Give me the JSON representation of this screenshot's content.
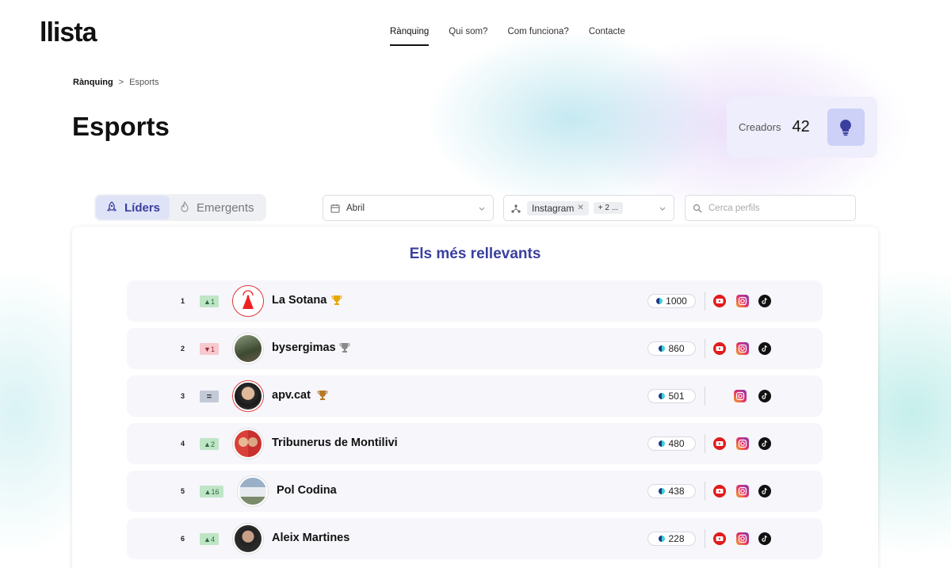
{
  "header": {
    "logo": "llista",
    "nav": [
      {
        "label": "Rànquing",
        "active": true
      },
      {
        "label": "Qui som?",
        "active": false
      },
      {
        "label": "Com funciona?",
        "active": false
      },
      {
        "label": "Contacte",
        "active": false
      }
    ]
  },
  "breadcrumb": {
    "root": "Rànquing",
    "separator": ">",
    "current": "Esports"
  },
  "page_title": "Esports",
  "creators": {
    "label": "Creadors",
    "count": "42",
    "icon": "lightbulb-icon"
  },
  "tabs": [
    {
      "label": "Líders",
      "icon": "rocket-icon",
      "active": true
    },
    {
      "label": "Emergents",
      "icon": "flame-icon",
      "active": false
    }
  ],
  "filters": {
    "month": {
      "value": "Abril",
      "icon": "calendar-icon"
    },
    "network": {
      "chip": "Instagram",
      "more": "+ 2 ...",
      "icon": "network-icon"
    },
    "search": {
      "placeholder": "Cerca perfils",
      "icon": "search-icon"
    }
  },
  "panel_title": "Els més rellevants",
  "colors": {
    "accent": "#3a3f9e",
    "up": "#bfe5c7",
    "down": "#f8c9cf",
    "same": "#c3c9d6"
  },
  "rows": [
    {
      "rank": "1",
      "change": "▲1",
      "trend": "up",
      "name": "La Sotana",
      "trophy": "gold",
      "score": "1000",
      "networks": [
        "youtube",
        "instagram",
        "tiktok"
      ]
    },
    {
      "rank": "2",
      "change": "▼1",
      "trend": "down",
      "name": "bysergimas",
      "trophy": "silver",
      "score": "860",
      "networks": [
        "youtube",
        "instagram",
        "tiktok"
      ]
    },
    {
      "rank": "3",
      "change": "=",
      "trend": "same",
      "name": "apv.cat",
      "trophy": "bronze",
      "score": "501",
      "networks": [
        "instagram",
        "tiktok"
      ]
    },
    {
      "rank": "4",
      "change": "▲2",
      "trend": "up",
      "name": "Tribunerus de Montilivi",
      "trophy": "",
      "score": "480",
      "networks": [
        "youtube",
        "instagram",
        "tiktok"
      ]
    },
    {
      "rank": "5",
      "change": "▲16",
      "trend": "up",
      "name": "Pol Codina",
      "trophy": "",
      "score": "438",
      "networks": [
        "youtube",
        "instagram",
        "tiktok"
      ]
    },
    {
      "rank": "6",
      "change": "▲4",
      "trend": "up",
      "name": "Aleix Martines",
      "trophy": "",
      "score": "228",
      "networks": [
        "youtube",
        "instagram",
        "tiktok"
      ]
    }
  ]
}
